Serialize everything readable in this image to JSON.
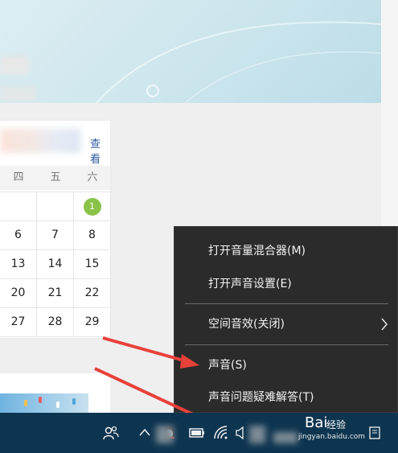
{
  "calendar": {
    "link_label": "查看",
    "weekdays": [
      "四",
      "五",
      "六"
    ],
    "rows": [
      [
        "",
        "",
        "1"
      ],
      [
        "6",
        "7",
        "8"
      ],
      [
        "13",
        "14",
        "15"
      ],
      [
        "20",
        "21",
        "22"
      ],
      [
        "27",
        "28",
        "29"
      ]
    ],
    "badge_color": "#8bc34a"
  },
  "context_menu": {
    "items": [
      {
        "label": "打开音量混合器(M)"
      },
      {
        "label": "打开声音设置(E)"
      },
      {
        "label": "空间音效(关闭)",
        "has_submenu": true
      },
      {
        "label": "声音(S)"
      },
      {
        "label": "声音问题疑难解答(T)"
      }
    ]
  },
  "taskbar": {
    "icons": [
      "people-icon",
      "chevron-up-icon",
      "qq-icon",
      "battery-icon",
      "wifi-icon",
      "speaker-icon",
      "notification-icon"
    ],
    "color": "#0e3550"
  },
  "watermark": {
    "logo": "Bai",
    "label": "经验",
    "url": "jingyan.baidu.com"
  },
  "colors": {
    "menu_bg": "#2b2b2b",
    "arrow": "#e8413a"
  }
}
